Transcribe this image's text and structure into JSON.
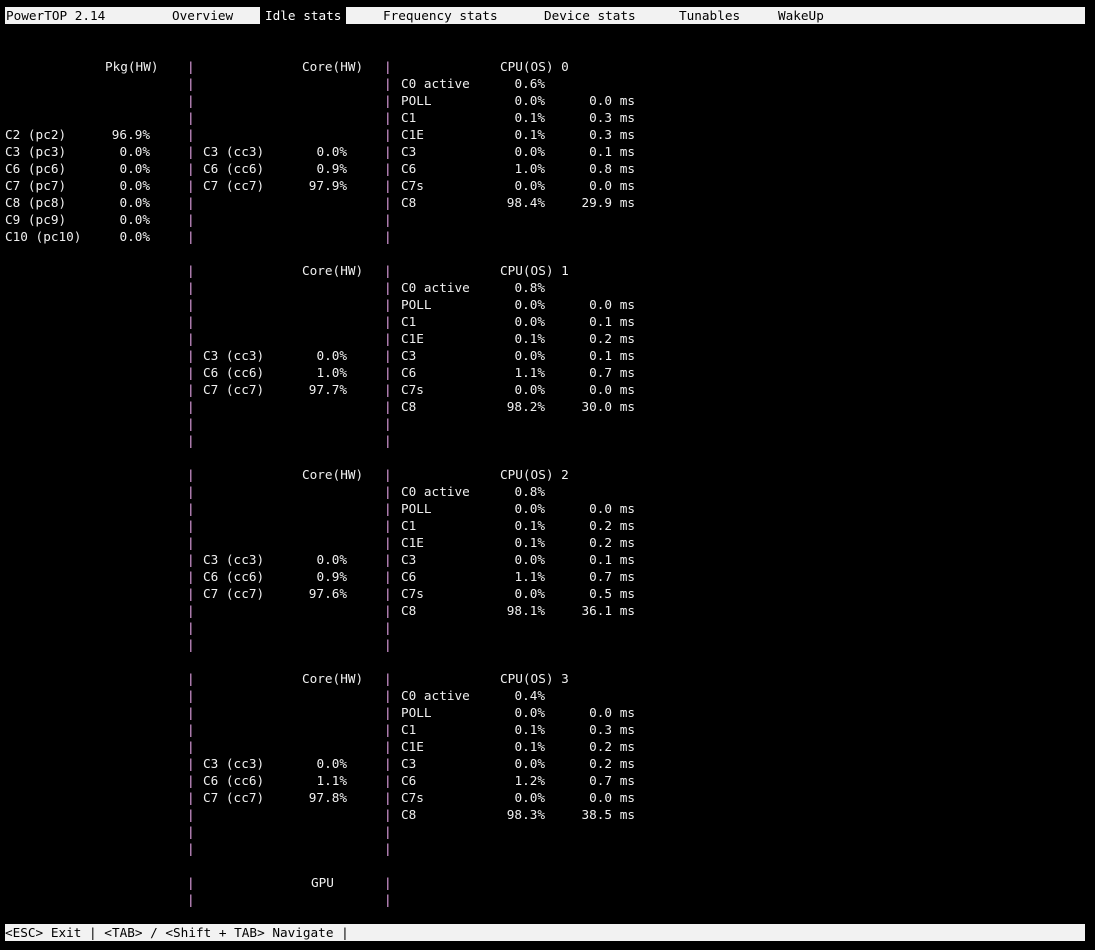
{
  "tabs": [
    {
      "id": "powertop",
      "label": "PowerTOP 2.14",
      "active": false
    },
    {
      "id": "overview",
      "label": "Overview",
      "active": false
    },
    {
      "id": "idle-stats",
      "label": "Idle stats",
      "active": true
    },
    {
      "id": "frequency-stats",
      "label": "Frequency stats",
      "active": false
    },
    {
      "id": "device-stats",
      "label": "Device stats",
      "active": false
    },
    {
      "id": "tunables",
      "label": "Tunables",
      "active": false
    },
    {
      "id": "wakeup",
      "label": "WakeUp",
      "active": false
    }
  ],
  "package": {
    "header": "Pkg(HW)",
    "states": [
      {
        "name": "C2 (pc2)",
        "value": "96.9%"
      },
      {
        "name": "C3 (pc3)",
        "value": "0.0%"
      },
      {
        "name": "C6 (pc6)",
        "value": "0.0%"
      },
      {
        "name": "C7 (pc7)",
        "value": "0.0%"
      },
      {
        "name": "C8 (pc8)",
        "value": "0.0%"
      },
      {
        "name": "C9 (pc9)",
        "value": "0.0%"
      },
      {
        "name": "C10 (pc10)",
        "value": "0.0%"
      }
    ]
  },
  "cores": [
    {
      "core_header": "Core(HW)",
      "core_states": [
        {
          "name": "C3 (cc3)",
          "value": "0.0%"
        },
        {
          "name": "C6 (cc6)",
          "value": "0.9%"
        },
        {
          "name": "C7 (cc7)",
          "value": "97.9%"
        }
      ],
      "cpu_header": "CPU(OS) 0",
      "active_label": "C0 active",
      "active_value": "0.6%",
      "cpu_states": [
        {
          "name": "POLL",
          "pct": "0.0%",
          "time": "0.0 ms"
        },
        {
          "name": "C1",
          "pct": "0.1%",
          "time": "0.3 ms"
        },
        {
          "name": "C1E",
          "pct": "0.1%",
          "time": "0.3 ms"
        },
        {
          "name": "C3",
          "pct": "0.0%",
          "time": "0.1 ms"
        },
        {
          "name": "C6",
          "pct": "1.0%",
          "time": "0.8 ms"
        },
        {
          "name": "C7s",
          "pct": "0.0%",
          "time": "0.0 ms"
        },
        {
          "name": "C8",
          "pct": "98.4%",
          "time": "29.9 ms"
        }
      ]
    },
    {
      "core_header": "Core(HW)",
      "core_states": [
        {
          "name": "C3 (cc3)",
          "value": "0.0%"
        },
        {
          "name": "C6 (cc6)",
          "value": "1.0%"
        },
        {
          "name": "C7 (cc7)",
          "value": "97.7%"
        }
      ],
      "cpu_header": "CPU(OS) 1",
      "active_label": "C0 active",
      "active_value": "0.8%",
      "cpu_states": [
        {
          "name": "POLL",
          "pct": "0.0%",
          "time": "0.0 ms"
        },
        {
          "name": "C1",
          "pct": "0.0%",
          "time": "0.1 ms"
        },
        {
          "name": "C1E",
          "pct": "0.1%",
          "time": "0.2 ms"
        },
        {
          "name": "C3",
          "pct": "0.0%",
          "time": "0.1 ms"
        },
        {
          "name": "C6",
          "pct": "1.1%",
          "time": "0.7 ms"
        },
        {
          "name": "C7s",
          "pct": "0.0%",
          "time": "0.0 ms"
        },
        {
          "name": "C8",
          "pct": "98.2%",
          "time": "30.0 ms"
        }
      ]
    },
    {
      "core_header": "Core(HW)",
      "core_states": [
        {
          "name": "C3 (cc3)",
          "value": "0.0%"
        },
        {
          "name": "C6 (cc6)",
          "value": "0.9%"
        },
        {
          "name": "C7 (cc7)",
          "value": "97.6%"
        }
      ],
      "cpu_header": "CPU(OS) 2",
      "active_label": "C0 active",
      "active_value": "0.8%",
      "cpu_states": [
        {
          "name": "POLL",
          "pct": "0.0%",
          "time": "0.0 ms"
        },
        {
          "name": "C1",
          "pct": "0.1%",
          "time": "0.2 ms"
        },
        {
          "name": "C1E",
          "pct": "0.1%",
          "time": "0.2 ms"
        },
        {
          "name": "C3",
          "pct": "0.0%",
          "time": "0.1 ms"
        },
        {
          "name": "C6",
          "pct": "1.1%",
          "time": "0.7 ms"
        },
        {
          "name": "C7s",
          "pct": "0.0%",
          "time": "0.5 ms"
        },
        {
          "name": "C8",
          "pct": "98.1%",
          "time": "36.1 ms"
        }
      ]
    },
    {
      "core_header": "Core(HW)",
      "core_states": [
        {
          "name": "C3 (cc3)",
          "value": "0.0%"
        },
        {
          "name": "C6 (cc6)",
          "value": "1.1%"
        },
        {
          "name": "C7 (cc7)",
          "value": "97.8%"
        }
      ],
      "cpu_header": "CPU(OS) 3",
      "active_label": "C0 active",
      "active_value": "0.4%",
      "cpu_states": [
        {
          "name": "POLL",
          "pct": "0.0%",
          "time": "0.0 ms"
        },
        {
          "name": "C1",
          "pct": "0.1%",
          "time": "0.3 ms"
        },
        {
          "name": "C1E",
          "pct": "0.1%",
          "time": "0.2 ms"
        },
        {
          "name": "C3",
          "pct": "0.0%",
          "time": "0.2 ms"
        },
        {
          "name": "C6",
          "pct": "1.2%",
          "time": "0.7 ms"
        },
        {
          "name": "C7s",
          "pct": "0.0%",
          "time": "0.0 ms"
        },
        {
          "name": "C8",
          "pct": "98.3%",
          "time": "38.5 ms"
        }
      ]
    }
  ],
  "gpu_header": "GPU",
  "separator": "|",
  "status_bar": "<ESC> Exit | <TAB> / <Shift + TAB> Navigate |",
  "colors": {
    "background": "#000000",
    "bar": "#f2f2f2",
    "separator": "#e9a6ea",
    "text": "#f0f0f0"
  }
}
